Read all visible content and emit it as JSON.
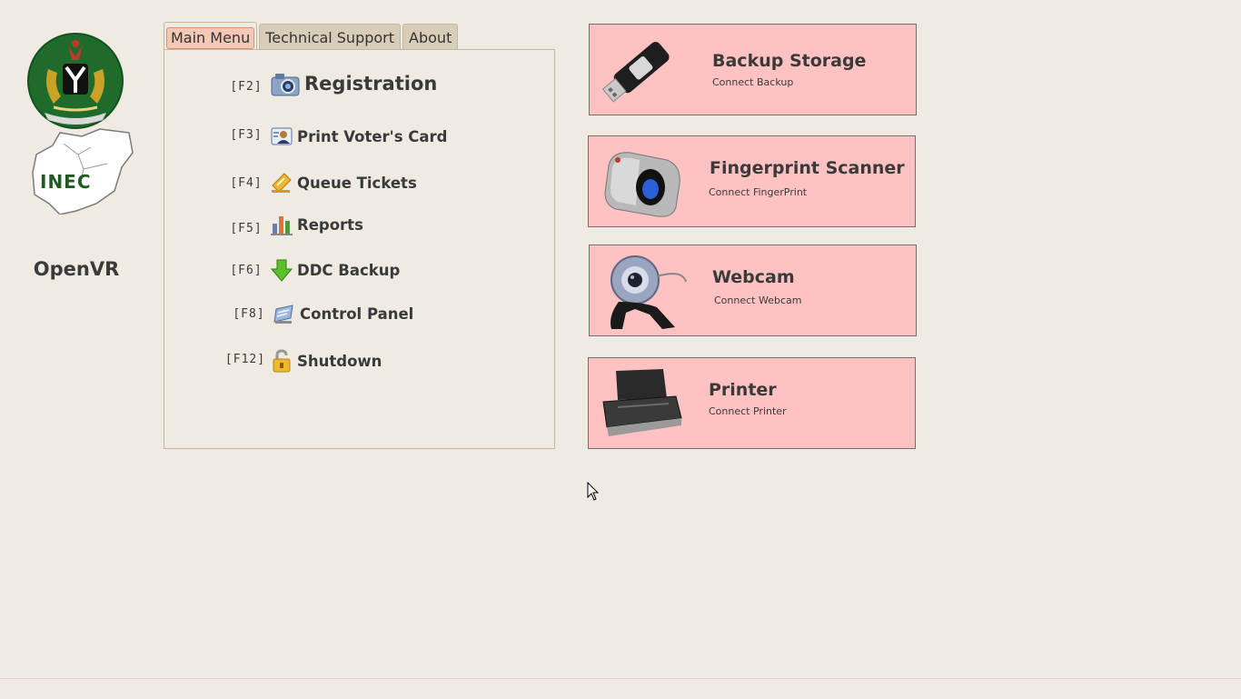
{
  "app": {
    "name": "OpenVR",
    "logo_text": "INEC"
  },
  "tabs": [
    {
      "label": "Main Menu",
      "active": true
    },
    {
      "label": "Technical Support",
      "active": false
    },
    {
      "label": "About",
      "active": false
    }
  ],
  "menu": [
    {
      "key": "[F2]",
      "label": "Registration",
      "icon": "camera-icon"
    },
    {
      "key": "[F3]",
      "label": "Print Voter's Card",
      "icon": "id-card-icon"
    },
    {
      "key": "[F4]",
      "label": "Queue Tickets",
      "icon": "ticket-icon"
    },
    {
      "key": "[F5]",
      "label": "Reports",
      "icon": "bar-chart-icon"
    },
    {
      "key": "[F6]",
      "label": "DDC Backup",
      "icon": "download-arrow-icon"
    },
    {
      "key": "[F8]",
      "label": "Control Panel",
      "icon": "control-panel-icon"
    },
    {
      "key": "[F12]",
      "label": "Shutdown",
      "icon": "padlock-icon"
    }
  ],
  "devices": [
    {
      "title": "Backup Storage",
      "subtitle": "Connect Backup",
      "icon": "usb-drive-icon"
    },
    {
      "title": "Fingerprint Scanner",
      "subtitle": "Connect FingerPrint",
      "icon": "fingerprint-scanner-icon"
    },
    {
      "title": "Webcam",
      "subtitle": "Connect Webcam",
      "icon": "webcam-icon"
    },
    {
      "title": "Printer",
      "subtitle": "Connect Printer",
      "icon": "printer-icon"
    }
  ],
  "colors": {
    "background": "#efebe3",
    "card": "#ffc2c2",
    "tab_active": "#f4c8b6",
    "tab_inactive": "#d8cdb8"
  }
}
